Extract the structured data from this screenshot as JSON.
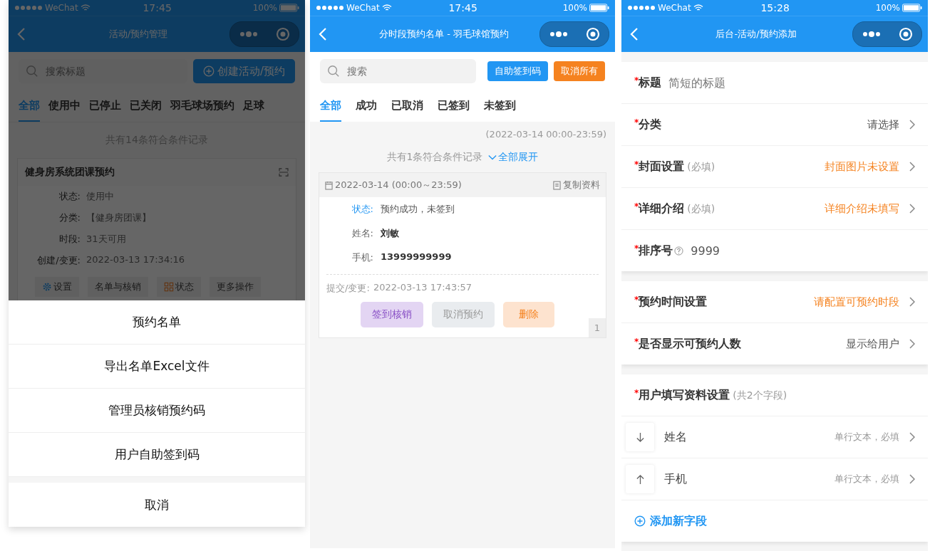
{
  "manage_screen": {
    "status_bar": {
      "carrier": "WeChat",
      "time": "17:45",
      "battery": "100%"
    },
    "nav": {
      "title": "活动/预约管理"
    },
    "search": {
      "placeholder": "搜索标题"
    },
    "create_button": "创建活动/预约",
    "tabs": [
      {
        "label": "全部",
        "selected": true
      },
      {
        "label": "使用中",
        "selected": false
      },
      {
        "label": "已停止",
        "selected": false
      },
      {
        "label": "已关闭",
        "selected": false
      },
      {
        "label": "羽毛球场预约",
        "selected": false
      },
      {
        "label": "足球",
        "selected": false
      }
    ],
    "count_text": "共有14条符合条件记录",
    "card": {
      "title": "健身房系统团课预约",
      "fields": [
        {
          "label": "状态:",
          "value": "使用中"
        },
        {
          "label": "分类:",
          "value": "【健身房团课】"
        },
        {
          "label": "时段:",
          "value": "31天可用"
        },
        {
          "label": "创建/变更:",
          "value": "2022-03-13 17:34:16"
        }
      ],
      "actions": [
        {
          "label": "设置",
          "kind": "settings"
        },
        {
          "label": "名单与核销",
          "kind": "plain"
        },
        {
          "label": "状态",
          "kind": "status"
        },
        {
          "label": "更多操作",
          "kind": "plain"
        }
      ]
    },
    "action_sheet": {
      "items": [
        "预约名单",
        "导出名单Excel文件",
        "管理员核销预约码",
        "用户自助签到码"
      ],
      "cancel": "取消"
    }
  },
  "booking_screen": {
    "status_bar": {
      "carrier": "WeChat",
      "time": "17:45",
      "battery": "100%"
    },
    "nav": {
      "title": "分时段预约名单 - 羽毛球馆预约"
    },
    "search": {
      "placeholder": "搜索"
    },
    "buttons": [
      {
        "label": "自助签到码",
        "kind": "primary"
      },
      {
        "label": "取消所有",
        "kind": "warning"
      }
    ],
    "tabs": [
      {
        "label": "全部",
        "selected": true
      },
      {
        "label": "成功",
        "selected": false
      },
      {
        "label": "已取消",
        "selected": false
      },
      {
        "label": "已签到",
        "selected": false
      },
      {
        "label": "未签到",
        "selected": false
      }
    ],
    "time_range": "(2022-03-14 00:00-23:59)",
    "count_text": "共有1条符合条件记录",
    "expand_link": "全部展开",
    "record": {
      "date": "2022-03-14 (00:00～23:59)",
      "copy": "复制资料",
      "fields": [
        {
          "label": "状态:",
          "value": "预约成功，未签到",
          "kind": "status"
        },
        {
          "label": "姓名:",
          "value": "刘敏",
          "kind": "plain"
        },
        {
          "label": "手机:",
          "value": "13999999999",
          "kind": "plain"
        }
      ],
      "submitted": {
        "label": "提交/变更:",
        "value": "2022-03-13 17:43:57"
      },
      "actions": [
        {
          "label": "签到核销",
          "kind": "purple"
        },
        {
          "label": "取消预约",
          "kind": "grey"
        },
        {
          "label": "删除",
          "kind": "orange"
        }
      ],
      "page": "1"
    }
  },
  "add_screen": {
    "status_bar": {
      "carrier": "WeChat",
      "time": "15:28",
      "battery": "100%"
    },
    "nav": {
      "title": "后台-活动/预约添加"
    },
    "groups": [
      {
        "rows": [
          {
            "kind": "input",
            "mark": "*",
            "label": "标题",
            "placeholder": "简短的标题"
          },
          {
            "kind": "select",
            "mark": "*",
            "label": "分类",
            "value": "请选择",
            "warn": false
          },
          {
            "kind": "select",
            "mark": "*",
            "label": "封面设置",
            "note": "(必填)",
            "value": "封面图片未设置",
            "warn": true
          },
          {
            "kind": "select",
            "mark": "*",
            "label": "详细介绍",
            "note": "(必填)",
            "value": "详细介绍未填写",
            "warn": true
          },
          {
            "kind": "input",
            "mark": "*",
            "label": "排序号",
            "help": true,
            "value": "9999"
          }
        ]
      },
      {
        "rows": [
          {
            "kind": "select",
            "mark": "*",
            "label": "预约时间设置",
            "value": "请配置可预约时段",
            "warn": true
          },
          {
            "kind": "select",
            "mark": "*",
            "label": "是否显示可预约人数",
            "value": "显示给用户",
            "warn": false
          }
        ]
      }
    ],
    "fields_group": {
      "mark": "*",
      "label": "用户填写资料设置",
      "note": "(共2个字段)",
      "fields": [
        {
          "kind": "down",
          "name": "姓名",
          "type": "单行文本，必填"
        },
        {
          "kind": "up",
          "name": "手机",
          "type": "单行文本，必填"
        }
      ],
      "add_link": "添加新字段"
    }
  }
}
